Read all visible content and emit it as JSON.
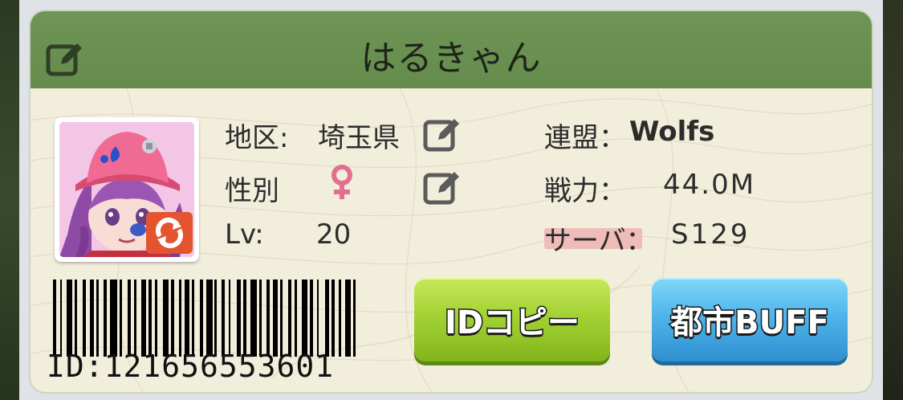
{
  "profile": {
    "name": "はるきゃん"
  },
  "info": {
    "region_label": "地区:",
    "region_value": "埼玉県",
    "gender_label": "性別",
    "gender_symbol": "♀",
    "level_label": "Lv:",
    "level_value": "20",
    "alliance_label": "連盟：",
    "alliance_value": "Wolfs",
    "power_label": "戦力：",
    "power_value": "44.0M",
    "server_label": "サーバ：",
    "server_value": "S129"
  },
  "id": {
    "text": "ID:121656553601"
  },
  "buttons": {
    "copy_label": "IDコピー",
    "buff_label": "都市BUFF"
  },
  "icons": {
    "header_edit": "edit-icon",
    "region_edit": "edit-icon",
    "gender_edit": "edit-icon",
    "avatar_change": "refresh-icon",
    "gender": "female-icon"
  },
  "colors": {
    "header": "#6a9150",
    "card": "#f1eedb",
    "copy_button": "#a3d234",
    "buff_button": "#4fb5ea",
    "gender_symbol": "#e26f8f",
    "server_highlight": "#f0b3b3"
  }
}
